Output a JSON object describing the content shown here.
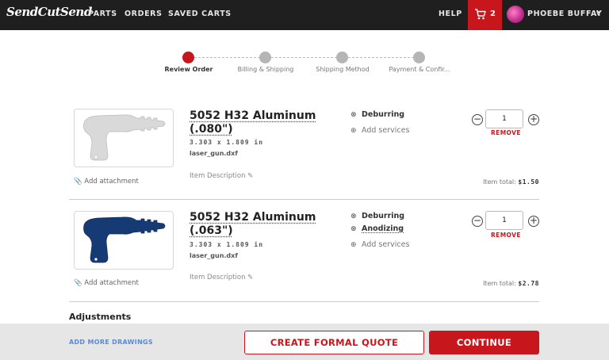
{
  "nav": {
    "logo": "SendCutSend",
    "links": [
      "PARTS",
      "ORDERS",
      "SAVED CARTS"
    ],
    "help": "HELP",
    "cart_count": "2",
    "user_name": "PHOEBE BUFFAY",
    "chevron": "∨",
    "colors": {
      "bar": "#1f1f1f",
      "accent": "#c8161d"
    }
  },
  "steps": [
    {
      "label": "Review Order",
      "active": true
    },
    {
      "label": "Billing & Shipping",
      "active": false
    },
    {
      "label": "Shipping Method",
      "active": false
    },
    {
      "label": "Payment & Confir...",
      "active": false
    }
  ],
  "items": [
    {
      "title_line1": "5052 H32 Aluminum",
      "title_line2": "(.080\")",
      "dims": "3.303 x 1.809 in",
      "file": "laser_gun.dxf",
      "description": "Item Description",
      "attachment": "Add attachment",
      "service1": "Deburring",
      "add_services": "Add services",
      "quantity": "1",
      "remove": "REMOVE",
      "total_label": "Item total:",
      "total_value": "$1.50",
      "part_color": "#d9d9d9"
    },
    {
      "title_line1": "5052 H32 Aluminum",
      "title_line2": "(.063\")",
      "dims": "3.303 x 1.809 in",
      "file": "laser_gun.dxf",
      "description": "Item Description",
      "attachment": "Add attachment",
      "service1": "Deburring",
      "service2": "Anodizing",
      "add_services": "Add services",
      "quantity": "1",
      "remove": "REMOVE",
      "total_label": "Item total:",
      "total_value": "$2.78",
      "part_color": "#163a73"
    }
  ],
  "adjustments": "Adjustments",
  "footer": {
    "add_more": "ADD MORE DRAWINGS",
    "quote": "CREATE FORMAL QUOTE",
    "continue": "CONTINUE"
  }
}
